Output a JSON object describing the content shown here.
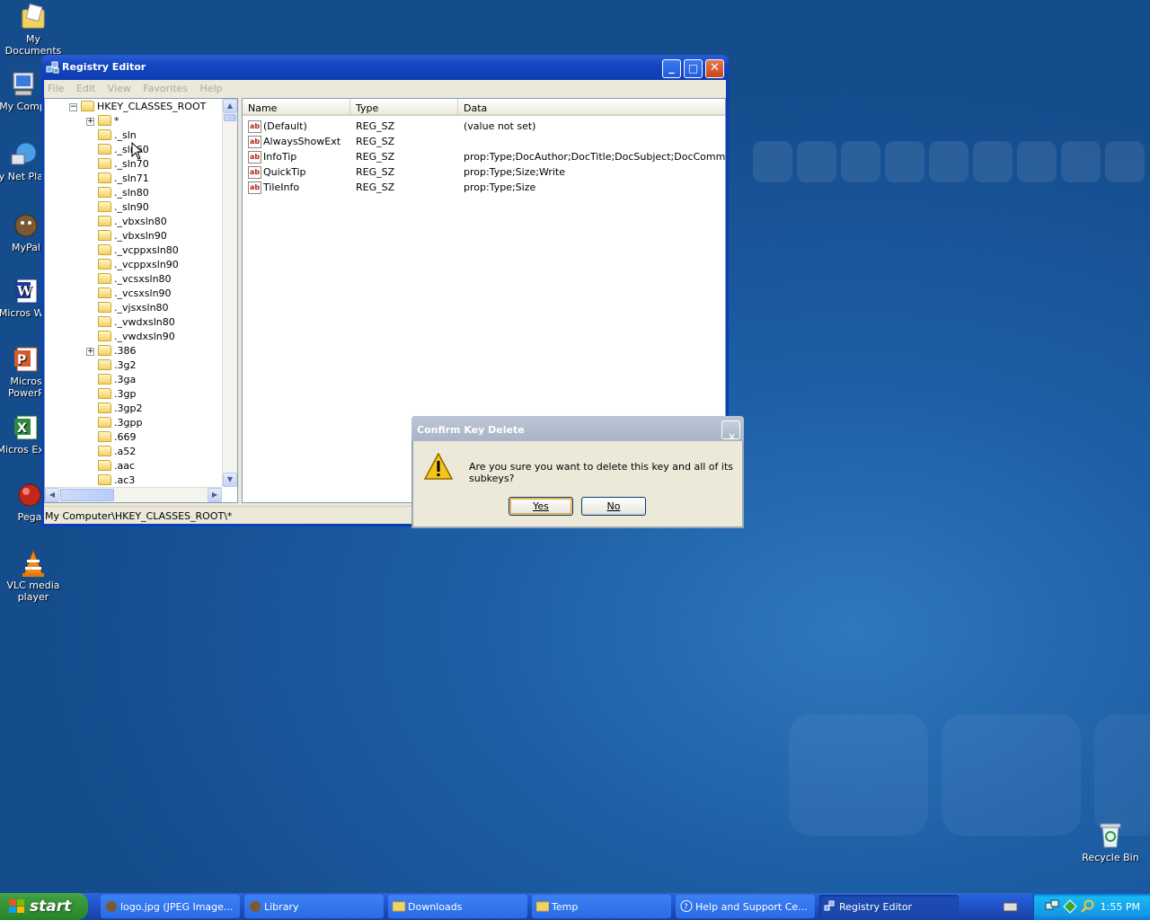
{
  "desktop": {
    "icons": [
      {
        "label": "My Documents"
      },
      {
        "label": "My Comp"
      },
      {
        "label": "My Net Place"
      },
      {
        "label": "MyPal"
      },
      {
        "label": "Micros Wor"
      },
      {
        "label": "Micros PowerP"
      },
      {
        "label": "Micros Exce"
      },
      {
        "label": "Pega"
      },
      {
        "label": "VLC media player"
      },
      {
        "label": "Recycle Bin"
      }
    ]
  },
  "window": {
    "title": "Registry Editor",
    "controls": {
      "minimize": "_",
      "maximize": "□",
      "close": "✕"
    },
    "menu": [
      "File",
      "Edit",
      "View",
      "Favorites",
      "Help"
    ],
    "tree": {
      "root": "HKEY_CLASSES_ROOT",
      "items": [
        "*",
        "._sln",
        "._sln60",
        "._sln70",
        "._sln71",
        "._sln80",
        "._sln90",
        "._vbxsln80",
        "._vbxsln90",
        "._vcppxsln80",
        "._vcppxsln90",
        "._vcsxsln80",
        "._vcsxsln90",
        "._vjsxsln80",
        "._vwdxsln80",
        "._vwdxsln90",
        ".386",
        ".3g2",
        ".3ga",
        ".3gp",
        ".3gp2",
        ".3gpp",
        ".669",
        ".a52",
        ".aac",
        ".ac3"
      ]
    },
    "list": {
      "columns": [
        "Name",
        "Type",
        "Data"
      ],
      "rows": [
        {
          "name": "(Default)",
          "type": "REG_SZ",
          "data": "(value not set)"
        },
        {
          "name": "AlwaysShowExt",
          "type": "REG_SZ",
          "data": ""
        },
        {
          "name": "InfoTip",
          "type": "REG_SZ",
          "data": "prop:Type;DocAuthor;DocTitle;DocSubject;DocComme..."
        },
        {
          "name": "QuickTip",
          "type": "REG_SZ",
          "data": "prop:Type;Size;Write"
        },
        {
          "name": "TileInfo",
          "type": "REG_SZ",
          "data": "prop:Type;Size"
        }
      ]
    },
    "status": "My Computer\\HKEY_CLASSES_ROOT\\*"
  },
  "dialog": {
    "title": "Confirm Key Delete",
    "message": "Are you sure you want to delete this key and all of its subkeys?",
    "yes_label": "Yes",
    "no_label": "No",
    "close": "✕"
  },
  "taskbar": {
    "start_label": "start",
    "tasks": [
      "logo.jpg (JPEG Image...",
      "Library",
      "Downloads",
      "Temp",
      "Help and Support Ce...",
      "Registry Editor"
    ],
    "clock": "1:55 PM"
  },
  "colors": {
    "titlebar": "#0d3bb0",
    "start": "#3c9a3c",
    "dialog_inactive": "#a9b4c6"
  }
}
